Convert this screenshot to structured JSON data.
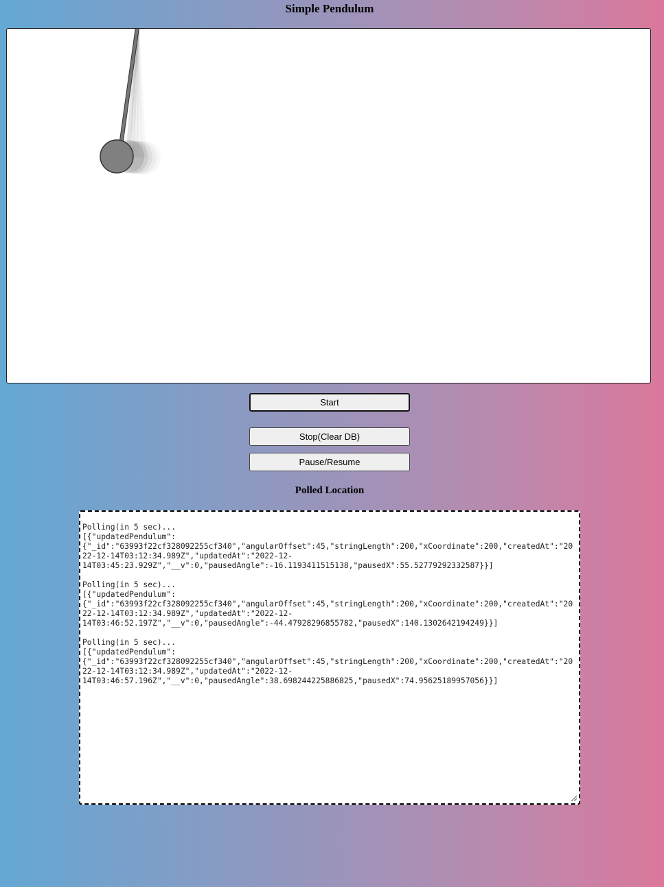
{
  "page": {
    "title": "Simple Pendulum"
  },
  "controls": {
    "start_label": "Start",
    "stop_label": "Stop(Clear DB)",
    "pause_label": "Pause/Resume"
  },
  "polled": {
    "heading": "Polled Location",
    "entries": [
      {
        "status": "Polling(in 5 sec)...",
        "payload": "[{\"updatedPendulum\":\n{\"_id\":\"63993f22cf328092255cf340\",\"angularOffset\":45,\"stringLength\":200,\"xCoordinate\":200,\"createdAt\":\"2022-12-14T03:12:34.989Z\",\"updatedAt\":\"2022-12-\n14T03:45:23.929Z\",\"__v\":0,\"pausedAngle\":-16.1193411515138,\"pausedX\":55.52779292332587}}]"
      },
      {
        "status": "Polling(in 5 sec)...",
        "payload": "[{\"updatedPendulum\":\n{\"_id\":\"63993f22cf328092255cf340\",\"angularOffset\":45,\"stringLength\":200,\"xCoordinate\":200,\"createdAt\":\"2022-12-14T03:12:34.989Z\",\"updatedAt\":\"2022-12-\n14T03:46:52.197Z\",\"__v\":0,\"pausedAngle\":-44.47928296855782,\"pausedX\":140.1302642194249}}]"
      },
      {
        "status": "Polling(in 5 sec)...",
        "payload": "[{\"updatedPendulum\":\n{\"_id\":\"63993f22cf328092255cf340\",\"angularOffset\":45,\"stringLength\":200,\"xCoordinate\":200,\"createdAt\":\"2022-12-14T03:12:34.989Z\",\"updatedAt\":\"2022-12-\n14T03:46:57.196Z\",\"__v\":0,\"pausedAngle\":38.698244225886825,\"pausedX\":74.95625189957056}}]"
      }
    ]
  },
  "colors": {
    "bob_fill": "#808080",
    "bob_stroke": "#333333",
    "rod": "#666666"
  }
}
